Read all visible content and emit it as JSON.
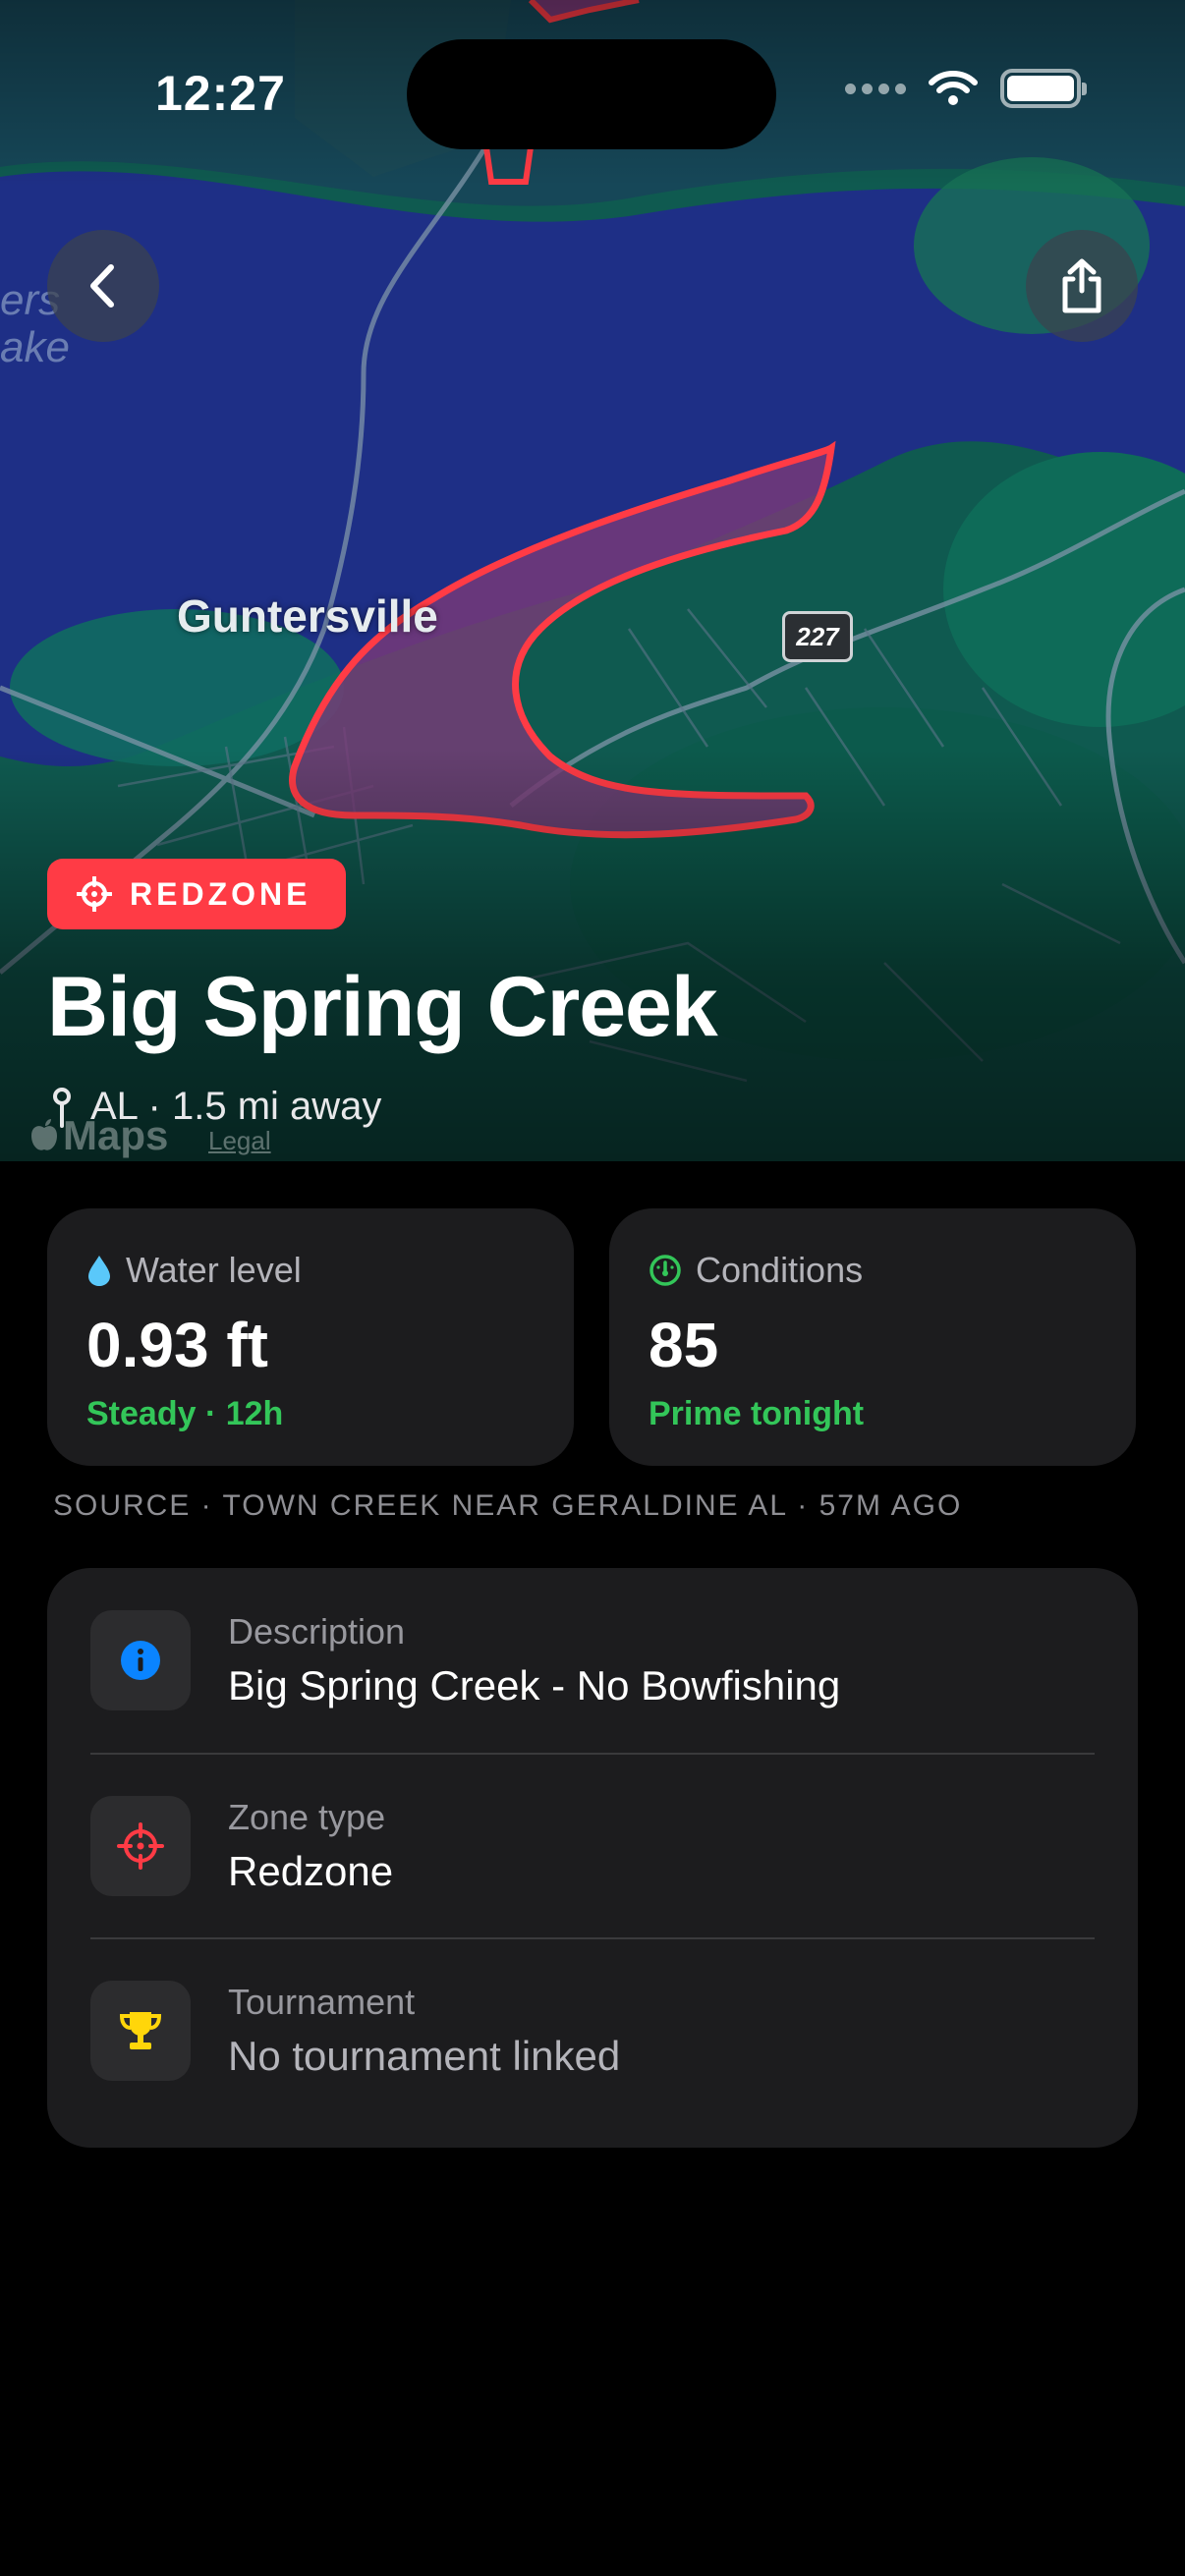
{
  "status_bar": {
    "time": "12:27"
  },
  "map": {
    "city_label": "Guntersville",
    "route_shield": "227",
    "lake_label_line1": "ers",
    "lake_label_line2": "ake",
    "attribution": "Maps",
    "legal": "Legal"
  },
  "header": {
    "badge": "REDZONE",
    "title": "Big Spring Creek",
    "subtitle": "AL · 1.5 mi away"
  },
  "stats": {
    "water": {
      "label": "Water level",
      "value": "0.93 ft",
      "note": "Steady · 12h"
    },
    "conditions": {
      "label": "Conditions",
      "value": "85",
      "note": "Prime tonight"
    }
  },
  "source": "SOURCE · TOWN CREEK NEAR GERALDINE AL · 57M AGO",
  "details": [
    {
      "label": "Description",
      "value": "Big Spring Creek - No Bowfishing",
      "icon": "info-icon"
    },
    {
      "label": "Zone type",
      "value": "Redzone",
      "icon": "crosshair-icon"
    },
    {
      "label": "Tournament",
      "value": "No tournament linked",
      "icon": "trophy-icon"
    }
  ],
  "colors": {
    "accent_red": "#ff3b45",
    "positive_green": "#33c659",
    "info_blue": "#0a84ff",
    "trophy_yellow": "#ffd60a",
    "water_blue": "#5ac8fa"
  }
}
